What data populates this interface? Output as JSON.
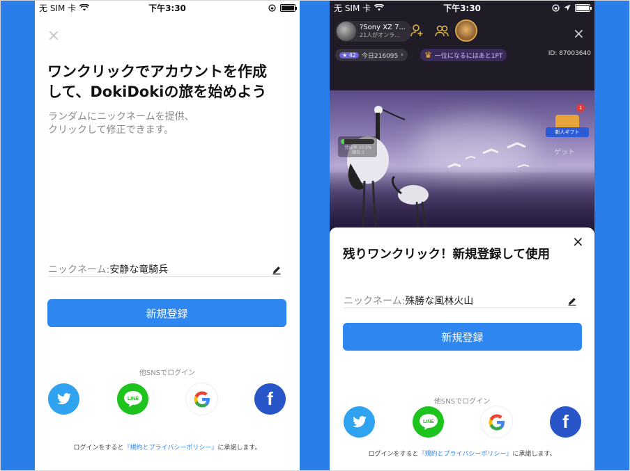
{
  "left_screen": {
    "status": {
      "carrier": "无 SIM 卡",
      "time": "下午3:30"
    },
    "close_glyph": "×",
    "title": "ワンクリックでアカウントを作成\nして、DokiDokiの旅を始めよう",
    "description": "ランダムにニックネームを提供、\nクリックして修正できます。",
    "nickname_label": "ニックネーム:",
    "nickname_value": "安静な竜騎兵",
    "register_button": "新規登録",
    "sns_caption": "他SNSでログイン",
    "sns": [
      "twitter-icon",
      "line-icon",
      "google-icon",
      "facebook-icon"
    ],
    "line_text": "LINE",
    "facebook_text": "f",
    "terms_prefix": "ログインをすると",
    "terms_link": "『規約とプライバシーポリシー』",
    "terms_suffix": "に承諾します。"
  },
  "right_screen": {
    "status": {
      "carrier": "无 SIM 卡",
      "time": "下午3:30"
    },
    "host": {
      "name": "?Sony XZ 7...",
      "viewers": "21人がオンラ..."
    },
    "close_glyph": "×",
    "stats": {
      "level": "42",
      "today": "今日216095",
      "rank_message": "一位になるにはあと1PT",
      "id": "ID: 87003640"
    },
    "progress": {
      "value": 0.101,
      "text": "完成率:10.0%\n順位:1"
    },
    "gift": {
      "badge": "1",
      "label": "新人ギフト",
      "get": "ゲット"
    },
    "sheet": {
      "title": "残りワンクリック！新規登録して使用",
      "nickname_label": "ニックネーム:",
      "nickname_value": "殊勝な風林火山",
      "register_button": "新規登録",
      "sns_caption": "他SNSでログイン",
      "line_text": "LINE",
      "facebook_text": "f",
      "terms_prefix": "ログインをすると",
      "terms_link": "『規約とプライバシーポリシー』",
      "terms_suffix": "に承諾します。"
    }
  },
  "colors": {
    "background": "#2b7de9",
    "primary": "#2e86f0",
    "twitter": "#2fa3ef",
    "line": "#1ec31e",
    "facebook": "#2856c8"
  }
}
